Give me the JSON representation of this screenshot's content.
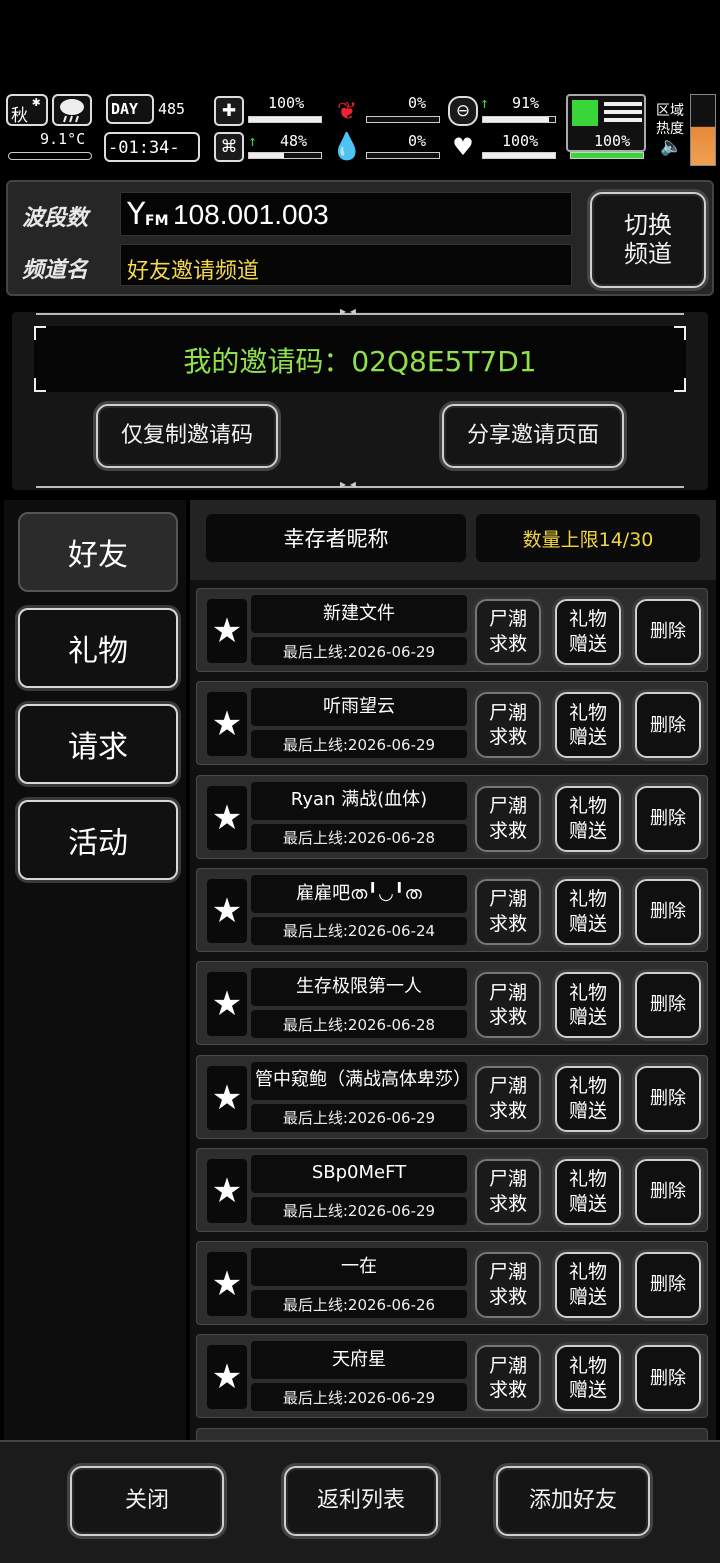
{
  "hud": {
    "season": "秋",
    "temperature": "9.1°C",
    "day_label": "DAY",
    "day_count": "485",
    "clock": "-01:34-",
    "health_pct": "100%",
    "health_level": 1.0,
    "stomach_pct": "0%",
    "stomach_level": 0.0,
    "pill_pct": "91%",
    "pill_level": 0.91,
    "stamina_pct": "100%",
    "stamina_level": 1.0,
    "brain_pct": "48%",
    "brain_level": 0.48,
    "water_pct": "0%",
    "water_level": 0.0,
    "heart_pct": "100%",
    "heart_level": 1.0,
    "zone_label": "区域",
    "heat_label": "热度",
    "icons": [
      "weather-snow-icon",
      "rain-cloud-icon",
      "medkit-icon",
      "stomach-icon",
      "pill-icon",
      "boot-icon",
      "brain-icon",
      "blood-drop-icon",
      "heart-icon",
      "speaker-icon"
    ]
  },
  "radio": {
    "band_label": "波段数",
    "band_value": "108.001.003",
    "fm_tag": "FM",
    "channel_label": "频道名",
    "channel_value": "好友邀请频道",
    "switch_button": "切换\n频道"
  },
  "invite": {
    "code_text": "我的邀请码：02Q8E5T7D1",
    "copy_button": "仅复制邀请码",
    "share_button": "分享邀请页面"
  },
  "tabs": [
    {
      "label": "好友",
      "active": true
    },
    {
      "label": "礼物",
      "active": false
    },
    {
      "label": "请求",
      "active": false
    },
    {
      "label": "活动",
      "active": false
    }
  ],
  "list_header": {
    "name_col": "幸存者昵称",
    "limit": "数量上限14/30"
  },
  "friends": [
    {
      "name": "新建文件",
      "last_online": "最后上线:2026-06-29"
    },
    {
      "name": "听雨望云",
      "last_online": "最后上线:2026-06-29"
    },
    {
      "name": "Ryan 满战(血体)",
      "last_online": "最后上线:2026-06-28"
    },
    {
      "name": "雇雇吧ത╹◡╹ത",
      "last_online": "最后上线:2026-06-24"
    },
    {
      "name": "生存极限第一人",
      "last_online": "最后上线:2026-06-28"
    },
    {
      "name": "管中窥鲍（满战高体卑莎）",
      "last_online": "最后上线:2026-06-29"
    },
    {
      "name": "SBp0MeFT",
      "last_online": "最后上线:2026-06-29"
    },
    {
      "name": "一在",
      "last_online": "最后上线:2026-06-26"
    },
    {
      "name": "天府星",
      "last_online": "最后上线:2026-06-29"
    }
  ],
  "row_buttons": {
    "zombie": "尸潮\n求救",
    "gift": "礼物\n赠送",
    "delete": "删除"
  },
  "bottom": {
    "close": "关闭",
    "rebate": "返利列表",
    "add_friend": "添加好友"
  },
  "colors": {
    "invite_green": "#8fe04a",
    "limit_yellow": "#f2d53c",
    "channel_yellow": "#f5d94a",
    "bar_green": "#39d63a"
  }
}
